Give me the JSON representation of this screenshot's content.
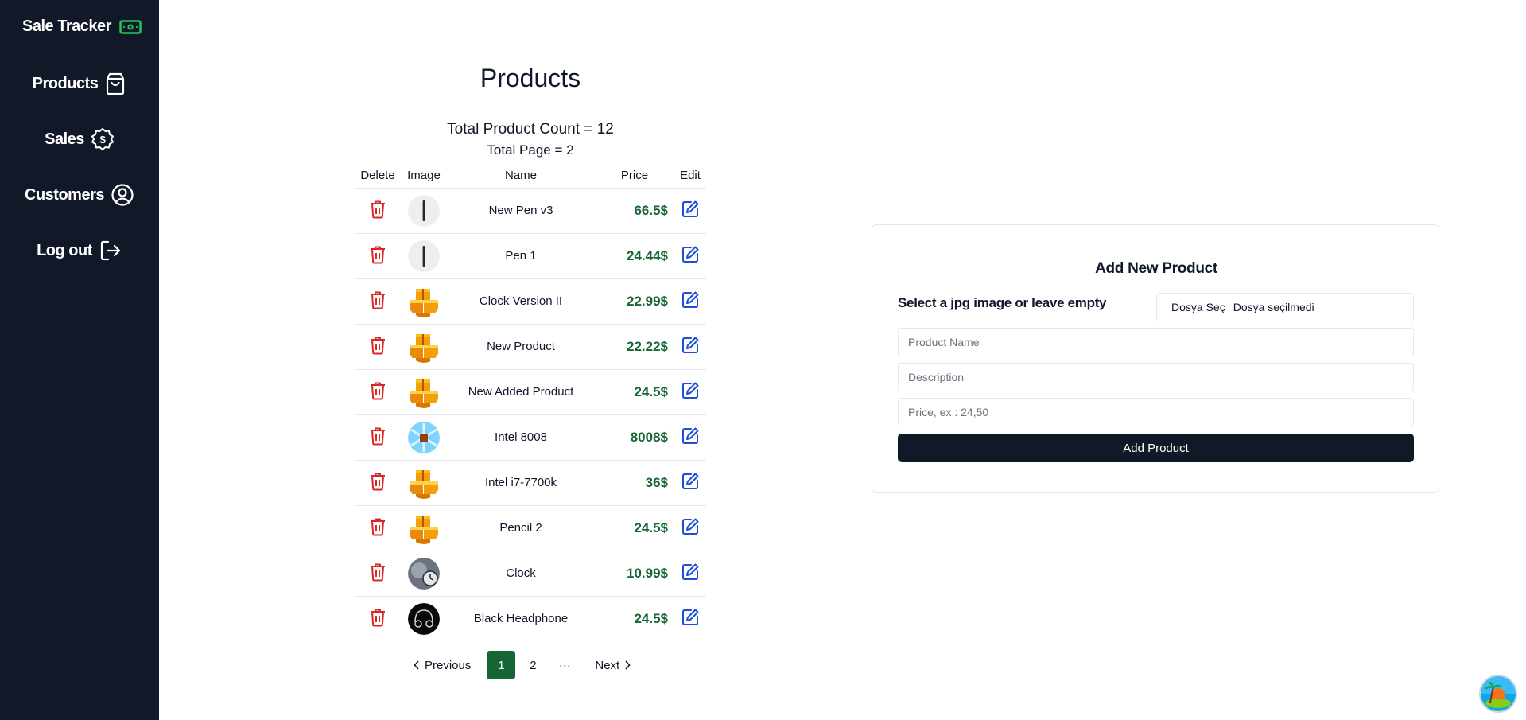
{
  "app": {
    "title": "Sale Tracker"
  },
  "nav": [
    {
      "label": "Products",
      "icon": "shopping-bag-icon"
    },
    {
      "label": "Sales",
      "icon": "dollar-badge-icon"
    },
    {
      "label": "Customers",
      "icon": "user-circle-icon"
    },
    {
      "label": "Log out",
      "icon": "logout-icon"
    }
  ],
  "page": {
    "title": "Products",
    "total_count_label": "Total Product Count = ",
    "total_count": "12",
    "total_page_label": "Total Page = 2"
  },
  "table": {
    "headers": [
      "Delete",
      "Image",
      "Name",
      "Price",
      "Edit"
    ],
    "rows": [
      {
        "name": "New Pen v3",
        "price": "66.5$",
        "image": "pen"
      },
      {
        "name": "Pen 1",
        "price": "24.44$",
        "image": "pen"
      },
      {
        "name": "Clock Version II",
        "price": "22.99$",
        "image": "boxes"
      },
      {
        "name": "New Product",
        "price": "22.22$",
        "image": "boxes"
      },
      {
        "name": "New Added Product",
        "price": "24.5$",
        "image": "boxes"
      },
      {
        "name": "Intel 8008",
        "price": "8008$",
        "image": "chip"
      },
      {
        "name": "Intel i7-7700k",
        "price": "36$",
        "image": "boxes"
      },
      {
        "name": "Pencil 2",
        "price": "24.5$",
        "image": "boxes"
      },
      {
        "name": "Clock",
        "price": "10.99$",
        "image": "clock"
      },
      {
        "name": "Black Headphone",
        "price": "24.5$",
        "image": "headphone"
      }
    ]
  },
  "pagination": {
    "previous": "Previous",
    "pages": [
      "1",
      "2"
    ],
    "ellipsis": "···",
    "next": "Next",
    "current": "1"
  },
  "form": {
    "title": "Add New Product",
    "file_label": "Select a jpg image or leave empty",
    "file_button": "Dosya Seç",
    "file_status": "Dosya seçilmedi",
    "name_placeholder": "Product Name",
    "description_placeholder": "Description",
    "price_placeholder": "Price, ex : 24,50",
    "submit_label": "Add Product"
  },
  "colors": {
    "sidebar": "#111827",
    "price": "#166534",
    "delete": "#dc2626",
    "edit": "#1d4ed8",
    "active_page": "#166534"
  }
}
